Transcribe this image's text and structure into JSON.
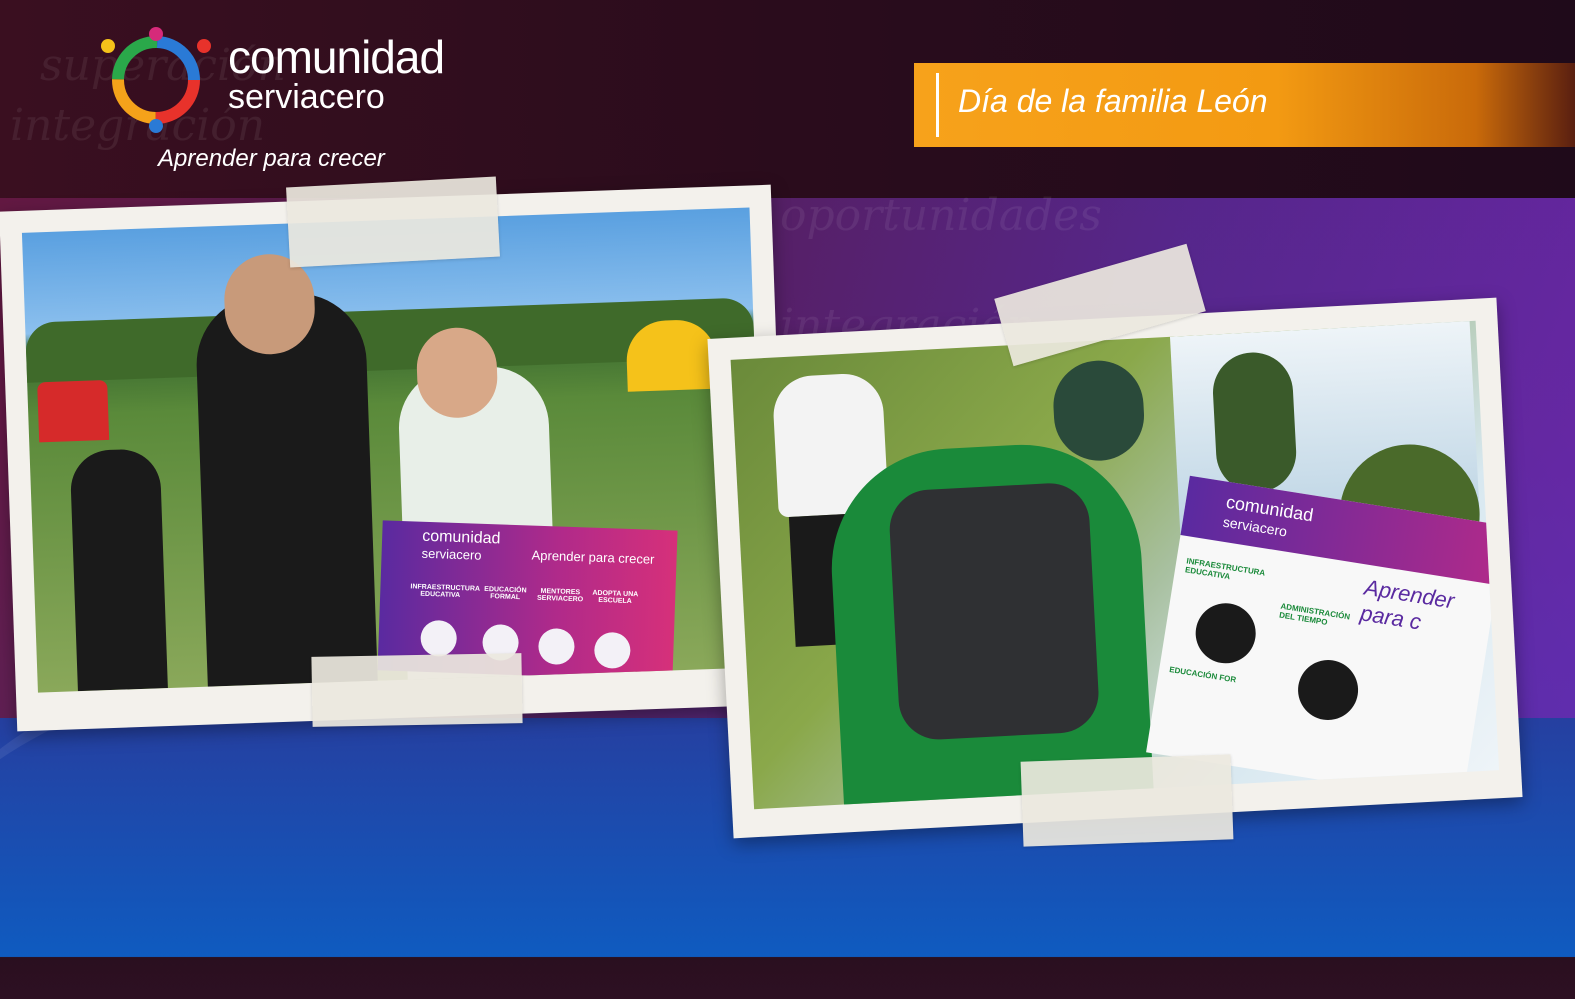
{
  "brand": {
    "name_line1": "comunidad",
    "name_line2": "serviacero",
    "tagline": "Aprender para crecer"
  },
  "event": {
    "title": "Día de la familia León"
  },
  "colors": {
    "accent_orange": "#f7a21b",
    "header_dark": "#2a0c1c",
    "purple": "#5a2a9a",
    "blue": "#0f5bc0"
  },
  "photos": {
    "left_sign": {
      "brand_line1": "comunidad",
      "brand_line2": "serviacero",
      "tagline": "Aprender para crecer",
      "items": [
        "INFRAESTRUCTURA EDUCATIVA",
        "EDUCACIÓN FORMAL",
        "MENTORES SERVIACERO",
        "ADOPTA UNA ESCUELA"
      ]
    },
    "right_sign": {
      "brand_line1": "comunidad",
      "brand_line2": "serviacero",
      "tagline": "Aprender para c",
      "items": [
        "INFRAESTRUCTURA EDUCATIVA",
        "ADMINISTRACIÓN DEL TIEMPO",
        "EDUCACIÓN FOR"
      ]
    }
  }
}
